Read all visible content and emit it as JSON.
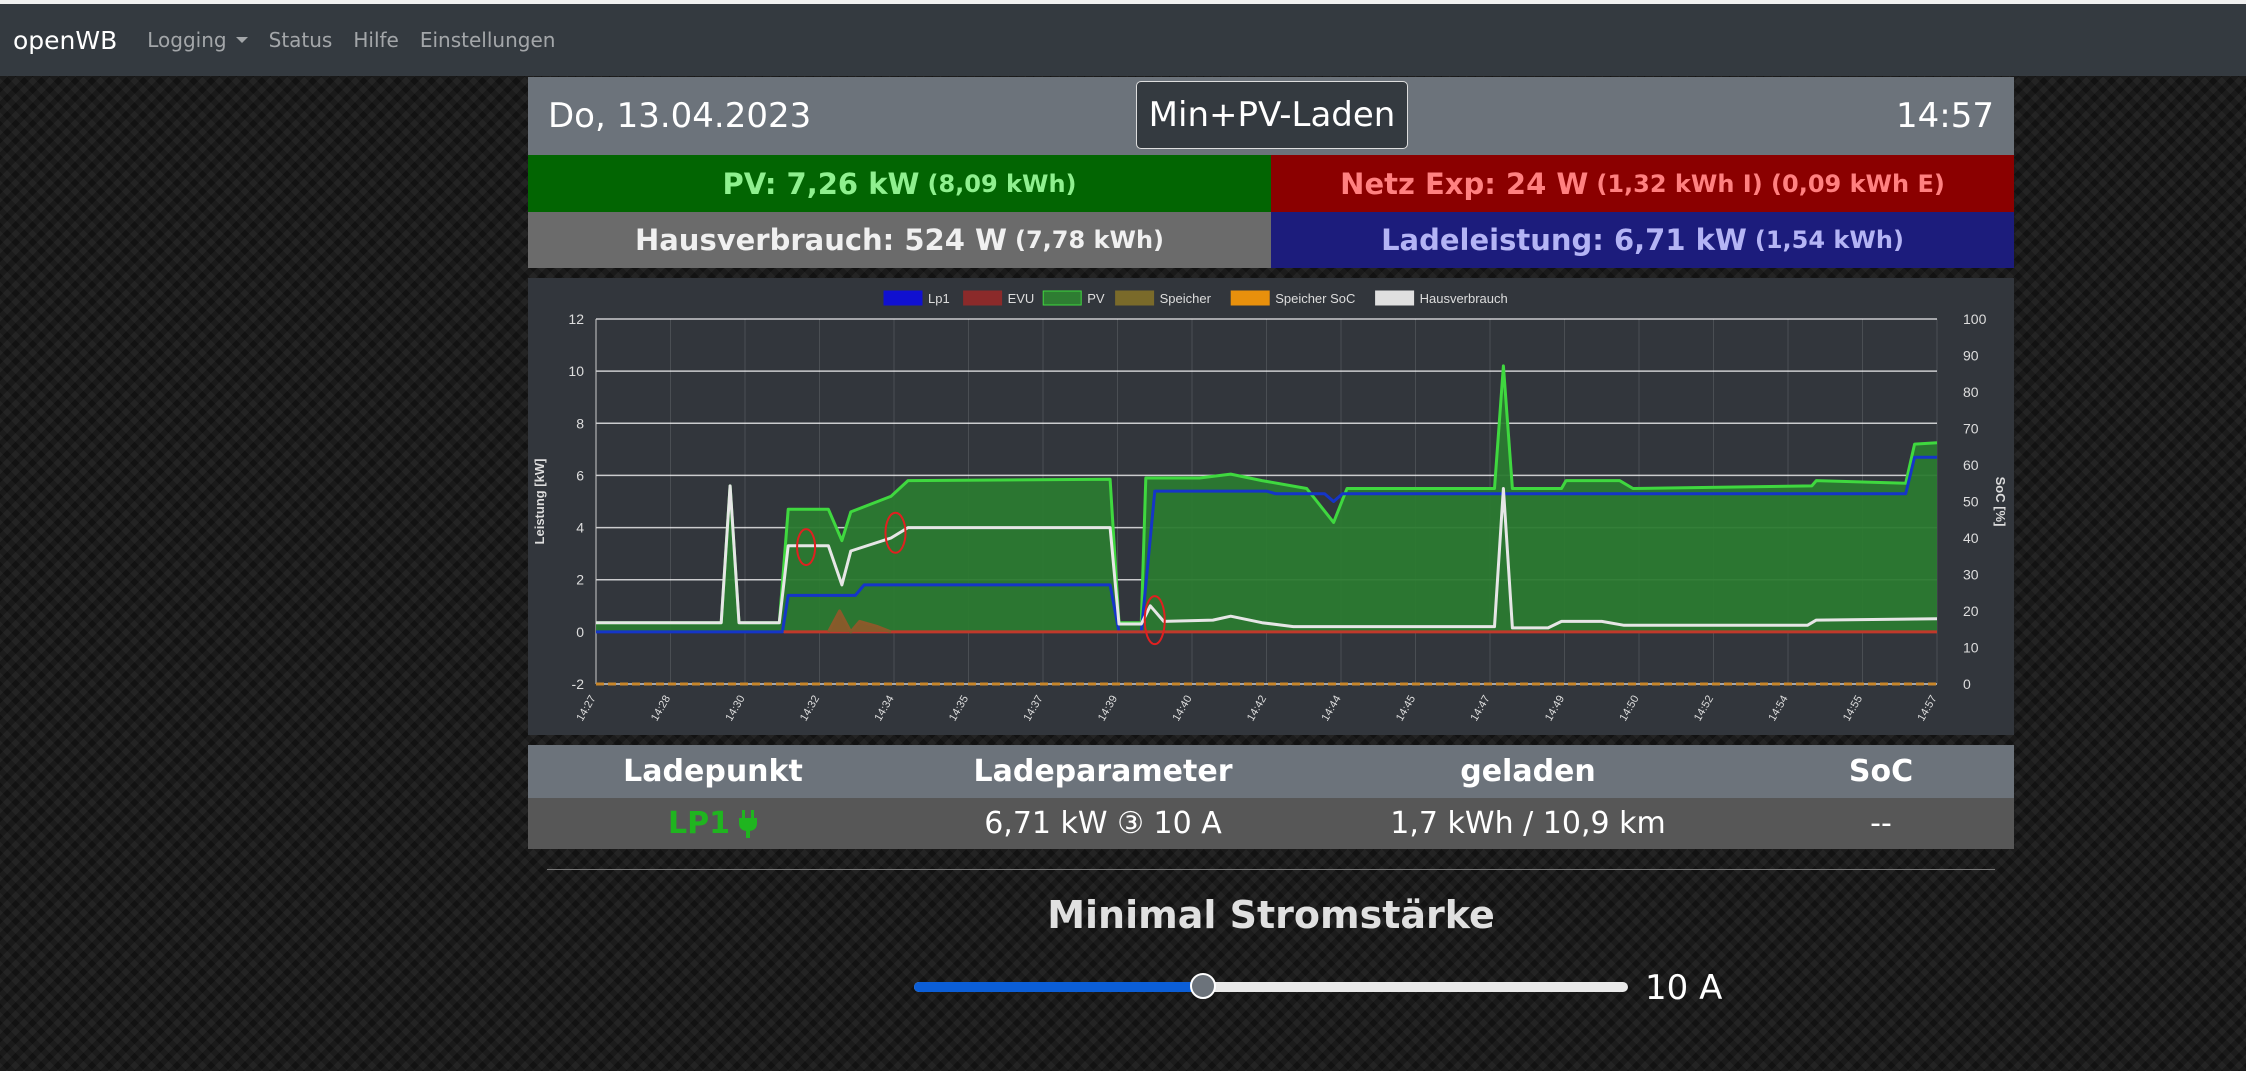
{
  "navbar": {
    "brand": "openWB",
    "items": [
      {
        "label": "Logging",
        "dropdown": true
      },
      {
        "label": "Status"
      },
      {
        "label": "Hilfe"
      },
      {
        "label": "Einstellungen"
      }
    ]
  },
  "header": {
    "date": "Do, 13.04.2023",
    "mode": "Min+PV-Laden",
    "time": "14:57"
  },
  "summary": {
    "pv": {
      "main": "PV: 7,26 kW",
      "sub": "(8,09 kWh)"
    },
    "netz": {
      "main": "Netz Exp: 24 W",
      "sub": "(1,32 kWh I) (0,09 kWh E)"
    },
    "haus": {
      "main": "Hausverbrauch: 524 W",
      "sub": "(7,78 kWh)"
    },
    "lade": {
      "main": "Ladeleistung: 6,71 kW",
      "sub": "(1,54 kWh)"
    }
  },
  "chart_data": {
    "type": "line",
    "title": "",
    "xlabel": "",
    "ylabel": "Leistung [kW]",
    "y2label": "SoC [%]",
    "ylim": [
      -2,
      12
    ],
    "yticks": [
      -2,
      0,
      2,
      4,
      6,
      8,
      10,
      12
    ],
    "y2lim": [
      0,
      100
    ],
    "y2ticks": [
      0,
      10,
      20,
      30,
      40,
      50,
      60,
      70,
      80,
      90,
      100
    ],
    "xlim_minutes": [
      0,
      30
    ],
    "x_tick_labels": [
      "14:27",
      "14:28",
      "14:30",
      "14:32",
      "14:34",
      "14:35",
      "14:37",
      "14:39",
      "14:40",
      "14:42",
      "14:44",
      "14:45",
      "14:47",
      "14:49",
      "14:50",
      "14:52",
      "14:54",
      "14:55",
      "14:57"
    ],
    "grid": true,
    "legend_position": "top",
    "legend": [
      {
        "name": "Lp1",
        "color": "#1010d0"
      },
      {
        "name": "EVU",
        "color": "#8b2a2a"
      },
      {
        "name": "PV",
        "color": "#2e7d32"
      },
      {
        "name": "Speicher",
        "color": "#7a6a2a"
      },
      {
        "name": "Speicher SoC",
        "color": "#e8900c"
      },
      {
        "name": "Hausverbrauch",
        "color": "#e0e0e0"
      }
    ],
    "series": [
      {
        "name": "PV",
        "color": "#3fd83f",
        "fill": "#2b7a30",
        "points": [
          [
            0,
            0.35
          ],
          [
            2.8,
            0.35
          ],
          [
            3.0,
            5.6
          ],
          [
            3.2,
            0.35
          ],
          [
            4.1,
            0.35
          ],
          [
            4.3,
            4.7
          ],
          [
            5.2,
            4.7
          ],
          [
            5.5,
            3.5
          ],
          [
            5.7,
            4.6
          ],
          [
            6.6,
            5.2
          ],
          [
            6.98,
            5.8
          ],
          [
            11.5,
            5.85
          ],
          [
            11.7,
            0.35
          ],
          [
            12.2,
            0.35
          ],
          [
            12.3,
            5.9
          ],
          [
            13.5,
            5.9
          ],
          [
            14.2,
            6.05
          ],
          [
            14.9,
            5.8
          ],
          [
            15.9,
            5.5
          ],
          [
            16.5,
            4.2
          ],
          [
            16.8,
            5.5
          ],
          [
            20.1,
            5.5
          ],
          [
            20.3,
            10.2
          ],
          [
            20.5,
            5.5
          ],
          [
            21.6,
            5.5
          ],
          [
            21.7,
            5.8
          ],
          [
            22.9,
            5.8
          ],
          [
            23.2,
            5.5
          ],
          [
            27.2,
            5.6
          ],
          [
            27.3,
            5.8
          ],
          [
            29.3,
            5.7
          ],
          [
            29.5,
            7.2
          ],
          [
            30,
            7.25
          ]
        ]
      },
      {
        "name": "Lp1",
        "color": "#1535c8",
        "points": [
          [
            0,
            0
          ],
          [
            4.17,
            0
          ],
          [
            4.3,
            1.4
          ],
          [
            5.8,
            1.4
          ],
          [
            6.0,
            1.8
          ],
          [
            11.5,
            1.8
          ],
          [
            11.7,
            0
          ],
          [
            12.2,
            0
          ],
          [
            12.5,
            5.4
          ],
          [
            15.0,
            5.4
          ],
          [
            15.2,
            5.3
          ],
          [
            16.3,
            5.3
          ],
          [
            16.5,
            5.0
          ],
          [
            16.7,
            5.3
          ],
          [
            29.3,
            5.3
          ],
          [
            29.5,
            6.7
          ],
          [
            30,
            6.7
          ]
        ]
      },
      {
        "name": "Hausverbrauch",
        "color": "#e6e6e6",
        "points": [
          [
            0,
            0.35
          ],
          [
            2.8,
            0.35
          ],
          [
            3.0,
            5.6
          ],
          [
            3.2,
            0.35
          ],
          [
            4.1,
            0.35
          ],
          [
            4.3,
            3.3
          ],
          [
            5.2,
            3.3
          ],
          [
            5.5,
            1.8
          ],
          [
            5.7,
            3.1
          ],
          [
            6.6,
            3.6
          ],
          [
            6.98,
            4.0
          ],
          [
            11.5,
            4.0
          ],
          [
            11.7,
            0.3
          ],
          [
            12.2,
            0.3
          ],
          [
            12.4,
            1.0
          ],
          [
            12.7,
            0.4
          ],
          [
            13.8,
            0.45
          ],
          [
            14.2,
            0.6
          ],
          [
            14.9,
            0.35
          ],
          [
            15.6,
            0.2
          ],
          [
            20.1,
            0.2
          ],
          [
            20.3,
            5.5
          ],
          [
            20.5,
            0.15
          ],
          [
            21.3,
            0.15
          ],
          [
            21.6,
            0.4
          ],
          [
            22.5,
            0.4
          ],
          [
            23.0,
            0.25
          ],
          [
            27.1,
            0.25
          ],
          [
            27.3,
            0.45
          ],
          [
            30,
            0.5
          ]
        ]
      },
      {
        "name": "EVU",
        "color": "#c0392b",
        "points": [
          [
            4.2,
            0
          ],
          [
            30,
            0
          ]
        ]
      },
      {
        "name": "Speicher",
        "color": "#8a5a2a",
        "fill": "#8a5a2a",
        "points": [
          [
            5.2,
            0
          ],
          [
            5.45,
            0.8
          ],
          [
            5.7,
            0
          ],
          [
            5.9,
            0.4
          ],
          [
            6.3,
            0.2
          ],
          [
            6.6,
            0
          ]
        ]
      },
      {
        "name": "Speicher SoC",
        "color": "#c8862a",
        "dashed": true,
        "axis": "y2",
        "points": [
          [
            0,
            0
          ],
          [
            30,
            0
          ]
        ]
      }
    ]
  },
  "table": {
    "headers": [
      "Ladepunkt",
      "Ladeparameter",
      "geladen",
      "SoC"
    ],
    "row": {
      "ladepunkt": "LP1",
      "ladeparameter": "6,71 kW ③ 10 A",
      "geladen": "1,7 kWh / 10,9 km",
      "soc": "--"
    }
  },
  "min_current": {
    "title": "Minimal Stromstärke",
    "value_label": "10 A",
    "slider_fraction": 0.405
  }
}
